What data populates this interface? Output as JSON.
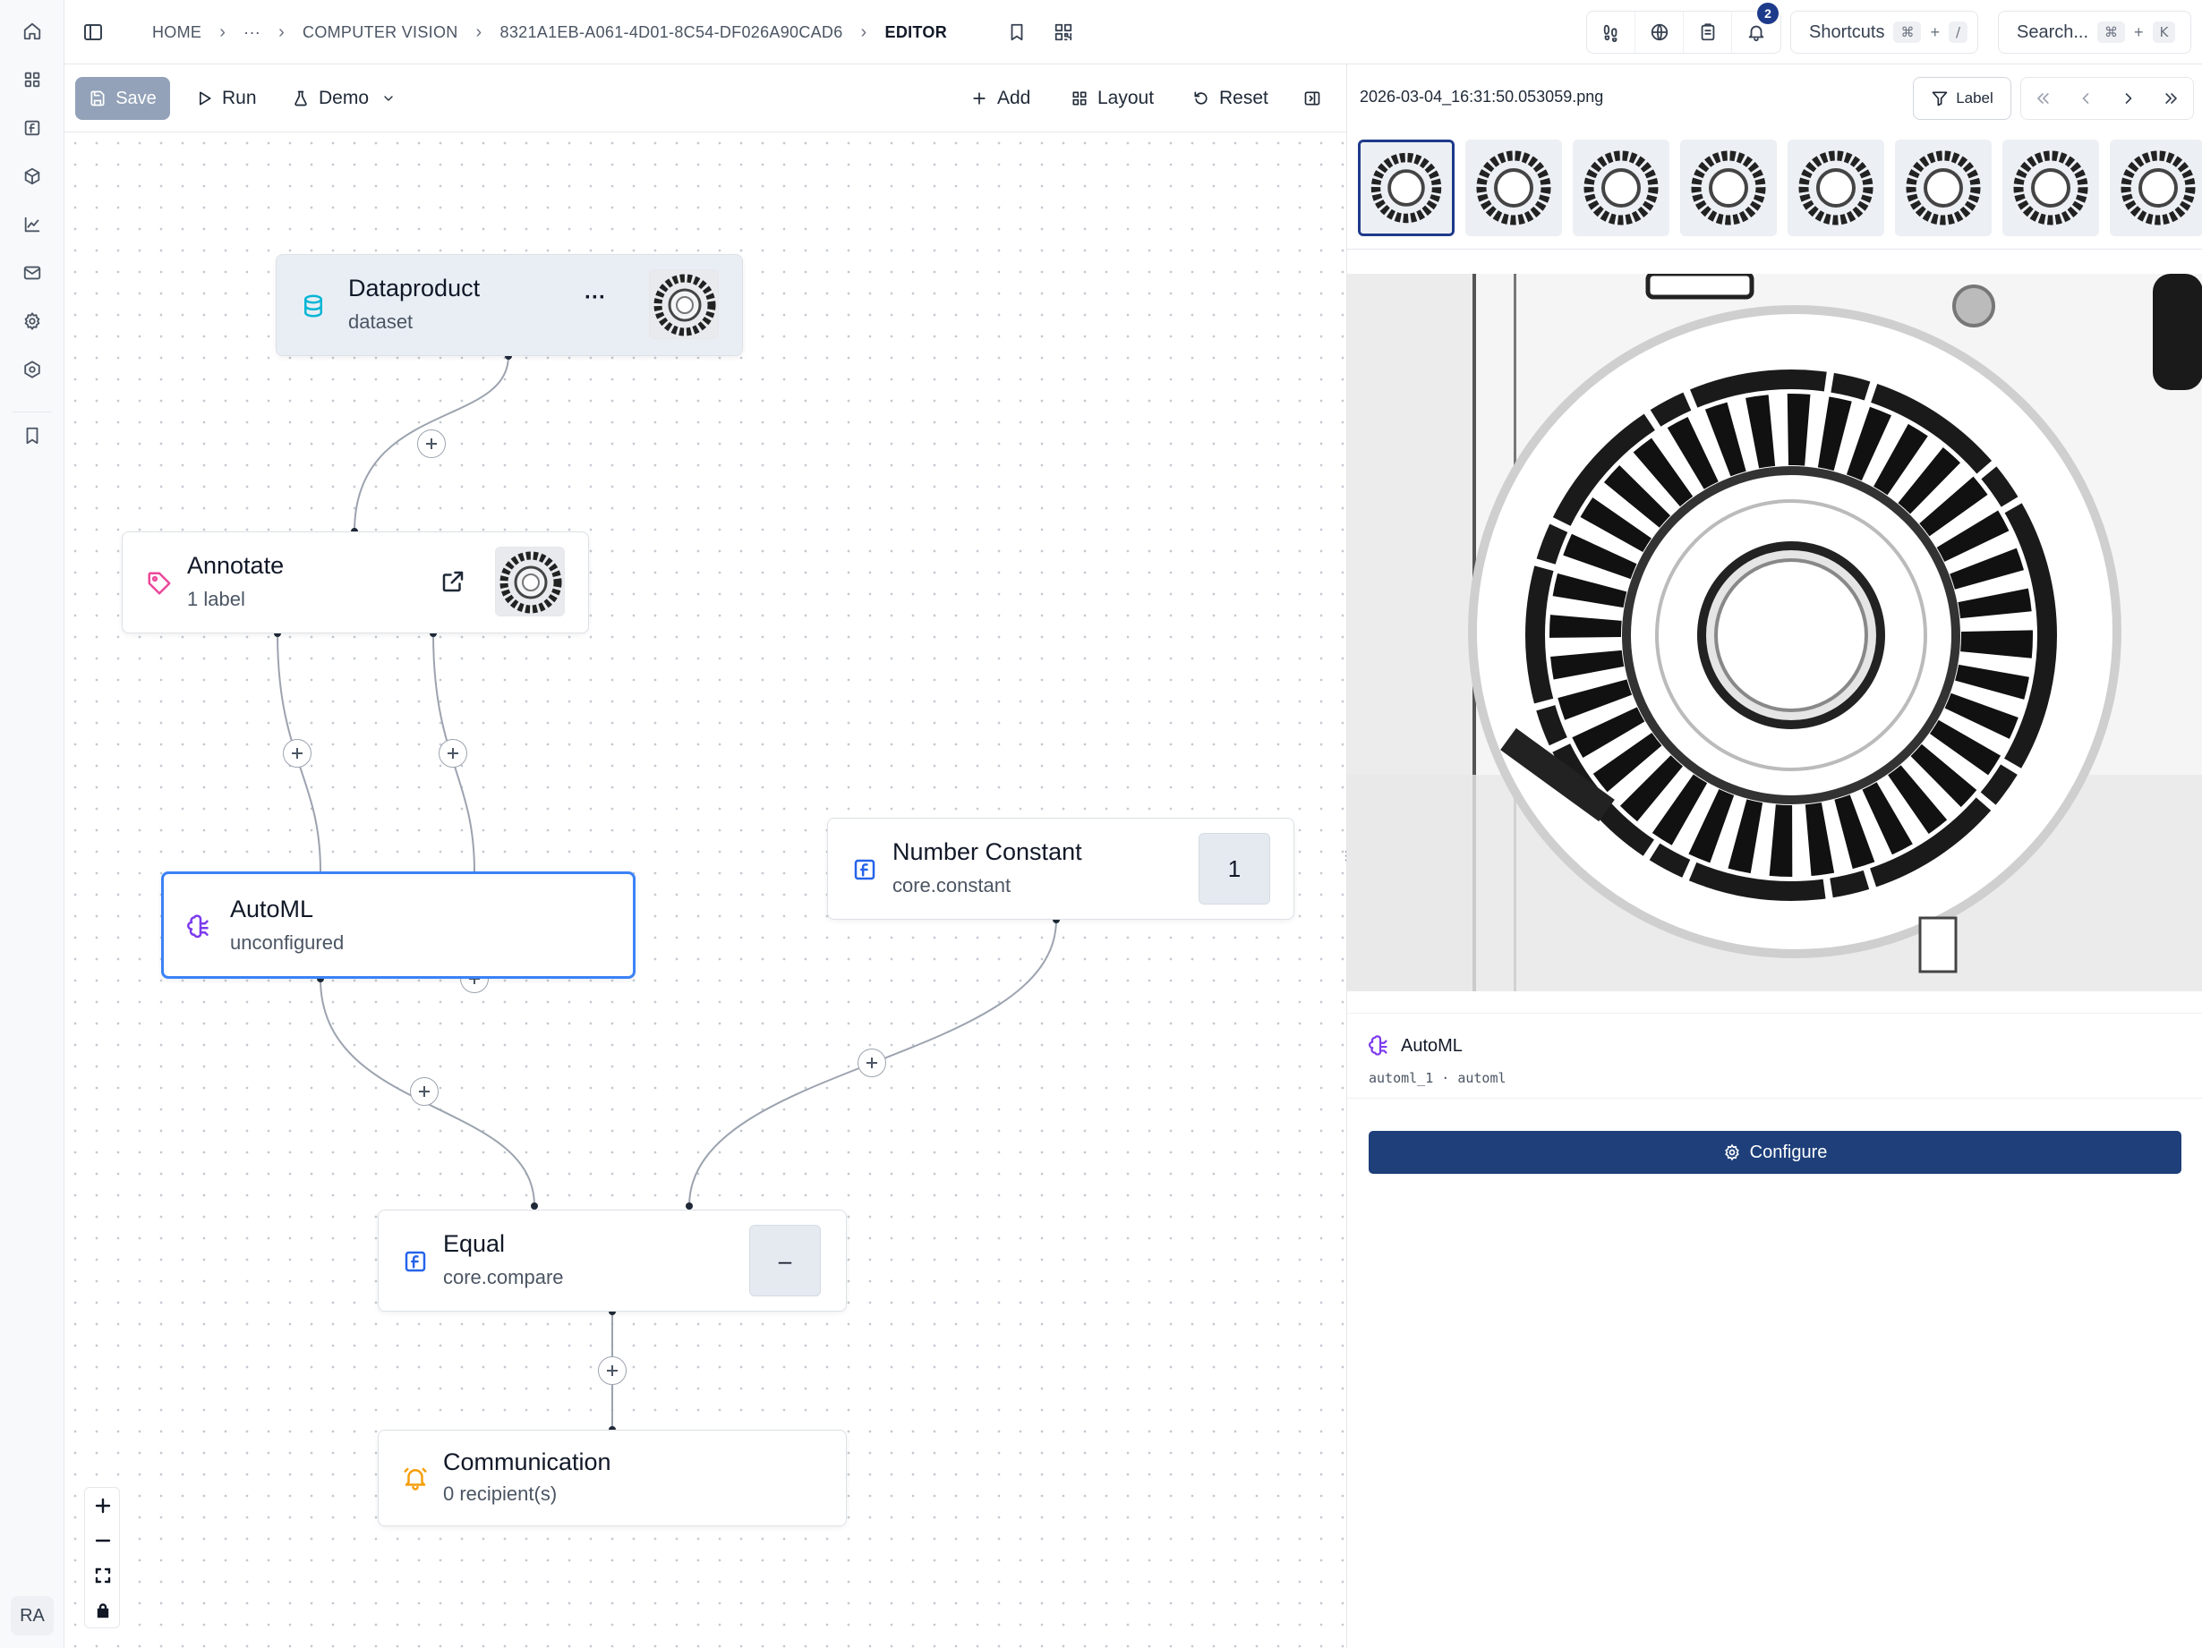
{
  "breadcrumb": {
    "home": "HOME",
    "ellipsis": "···",
    "section": "COMPUTER VISION",
    "id": "8321A1EB-A061-4D01-8C54-DF026A90CAD6",
    "current": "EDITOR"
  },
  "topbar": {
    "notification_count": "2",
    "shortcuts_label": "Shortcuts",
    "shortcuts_key1": "⌘",
    "shortcuts_plus": "+",
    "shortcuts_key2": "/",
    "search_label": "Search...",
    "search_key1": "⌘",
    "search_plus": "+",
    "search_key2": "K"
  },
  "toolbar": {
    "save_label": "Save",
    "run_label": "Run",
    "demo_label": "Demo",
    "add_label": "Add",
    "layout_label": "Layout",
    "reset_label": "Reset"
  },
  "nodes": {
    "dataproduct": {
      "title": "Dataproduct",
      "subtitle": "dataset",
      "menu": "···"
    },
    "annotate": {
      "title": "Annotate",
      "subtitle": "1 label"
    },
    "automl": {
      "title": "AutoML",
      "subtitle": "unconfigured"
    },
    "number_constant": {
      "title": "Number Constant",
      "subtitle": "core.constant",
      "value": "1"
    },
    "equal": {
      "title": "Equal",
      "subtitle": "core.compare",
      "value": "–"
    },
    "communication": {
      "title": "Communication",
      "subtitle": "0 recipient(s)"
    }
  },
  "user": {
    "initials": "RA"
  },
  "right_panel": {
    "filename": "2026-03-04_16:31:50.053059.png",
    "label_button": "Label",
    "thumbnail_count": 8,
    "selected_node": {
      "title": "AutoML",
      "subtitle": "automl_1 · automl"
    },
    "configure_label": "Configure"
  },
  "colors": {
    "accent": "#1e3f7a",
    "selected_border": "#3b82f6",
    "badge": "#1e3a8a",
    "dataproduct_icon": "#06b6d4",
    "annotate_icon": "#ec4899",
    "automl_icon": "#7c3aed",
    "constant_icon": "#2563eb",
    "communication_icon": "#f59e0b"
  }
}
